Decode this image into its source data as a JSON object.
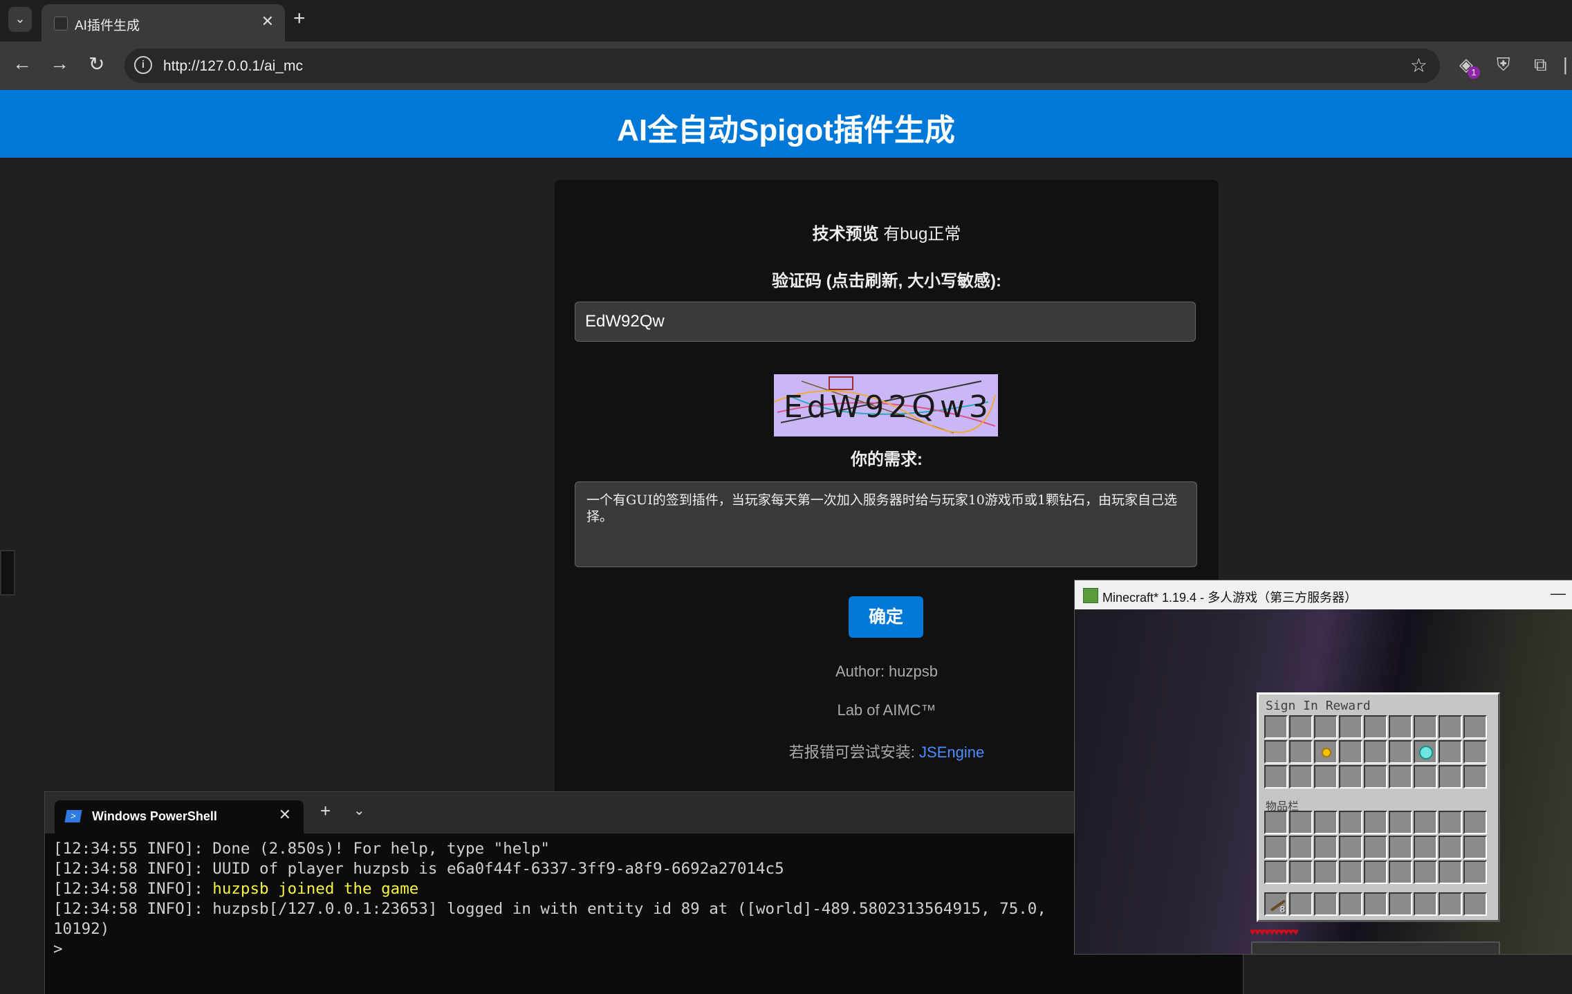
{
  "browser": {
    "tab_title": "AI插件生成",
    "url": "http://127.0.0.1/ai_mc",
    "extension_badge": "1"
  },
  "page": {
    "header_title": "AI全自动Spigot插件生成",
    "preview_bold": "技术预览",
    "preview_rest": " 有bug正常",
    "captcha_label": "验证码 (点击刷新, 大小写敏感):",
    "captcha_value": "EdW92Qw",
    "captcha_image_text": "EdW92Qw3",
    "need_label": "你的需求:",
    "need_text": "一个有GUI的签到插件，当玩家每天第一次加入服务器时给与玩家10游戏币或1颗钻石，由玩家自己选择。",
    "submit_label": "确定",
    "author": "Author: huzpsb",
    "lab": "Lab of AIMC™",
    "install_hint": "若报错可尝试安装: ",
    "install_link": "JSEngine"
  },
  "powershell": {
    "tab_title": "Windows PowerShell",
    "lines": [
      {
        "prefix": "[12:34:55 INFO]: ",
        "text": "Done (2.850s)! For help, type \"help\"",
        "highlight": false
      },
      {
        "prefix": "[12:34:58 INFO]: ",
        "text": "UUID of player huzpsb is e6a0f44f-6337-3ff9-a8f9-6692a27014c5",
        "highlight": false
      },
      {
        "prefix": "[12:34:58 INFO]: ",
        "text": "huzpsb joined the game",
        "highlight": true
      },
      {
        "prefix": "[12:34:58 INFO]: ",
        "text": "huzpsb[/127.0.0.1:23653] logged in with entity id 89 at ([world]-489.5802313564915, 75.0,",
        "highlight": false
      },
      {
        "prefix": "",
        "text": "10192)",
        "highlight": false
      },
      {
        "prefix": "",
        "text": ">",
        "highlight": false
      }
    ]
  },
  "minecraft": {
    "window_title": "Minecraft* 1.19.4 - 多人游戏（第三方服务器）",
    "gui_title": "Sign In Reward",
    "inventory_label": "物品栏",
    "stick_count": "8",
    "hotbar_count": "8"
  },
  "colors": {
    "accent": "#0078d7",
    "link": "#4c8dff",
    "console_highlight": "#f5f543"
  }
}
